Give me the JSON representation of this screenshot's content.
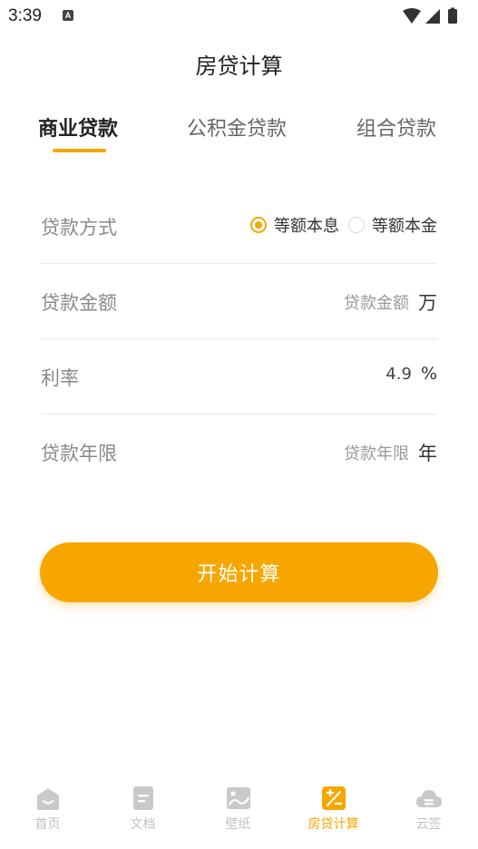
{
  "status": {
    "time": "3:39",
    "notification_glyph": "A"
  },
  "header": {
    "title": "房贷计算"
  },
  "tabs": [
    {
      "label": "商业贷款",
      "active": true
    },
    {
      "label": "公积金贷款",
      "active": false
    },
    {
      "label": "组合贷款",
      "active": false
    }
  ],
  "form": {
    "method": {
      "label": "贷款方式",
      "options": [
        {
          "label": "等额本息",
          "selected": true
        },
        {
          "label": "等额本金",
          "selected": false
        }
      ]
    },
    "amount": {
      "label": "贷款金额",
      "placeholder": "贷款金额",
      "unit": "万"
    },
    "rate": {
      "label": "利率",
      "value": "4.9",
      "unit": "%"
    },
    "term": {
      "label": "贷款年限",
      "placeholder": "贷款年限",
      "unit": "年"
    }
  },
  "action": {
    "button_label": "开始计算"
  },
  "bottom_nav": [
    {
      "label": "首页",
      "icon": "home-icon",
      "active": false
    },
    {
      "label": "文档",
      "icon": "document-icon",
      "active": false
    },
    {
      "label": "壁纸",
      "icon": "wallpaper-icon",
      "active": false
    },
    {
      "label": "房贷计算",
      "icon": "calculator-icon",
      "active": true
    },
    {
      "label": "云签",
      "icon": "cloud-icon",
      "active": false
    }
  ],
  "colors": {
    "accent": "#f7a600",
    "inactive": "#c2c2c2",
    "label": "#8a8a8a"
  }
}
